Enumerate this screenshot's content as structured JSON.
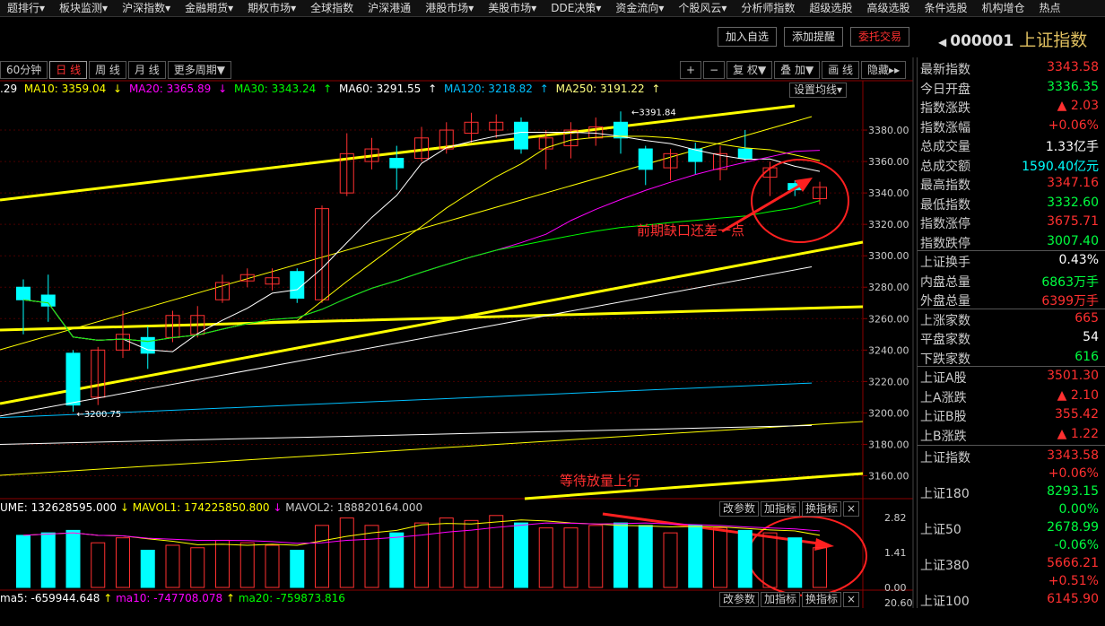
{
  "menu": [
    "题排行▾",
    "板块监测▾",
    "沪深指数▾",
    "金融期货▾",
    "期权市场▾",
    "全球指数",
    "沪深港通",
    "港股市场▾",
    "美股市场▾",
    "DDE决策▾",
    "资金流向▾",
    "个股风云▾",
    "分析师指数",
    "超级选股",
    "高级选股",
    "条件选股",
    "机构增仓",
    "热点"
  ],
  "top_buttons": {
    "add_watch": "加入自选",
    "add_alert": "添加提醒",
    "trade": "委托交易"
  },
  "title": {
    "code": "000001",
    "name": "上证指数"
  },
  "periods": {
    "m60": "60分钟",
    "day": "日 线",
    "week": "周 线",
    "month": "月 线",
    "more": "更多周期▼"
  },
  "tools": {
    "plus": "+",
    "minus": "−",
    "fq": "复 权▼",
    "overlay": "叠 加▼",
    "draw": "画 线",
    "hide": "隐藏▸▸"
  },
  "ma_bar": {
    "ma5": ".29",
    "ma10": "MA10: 3359.04",
    "ma20": "MA20: 3365.89",
    "ma30": "MA30: 3343.24",
    "ma60": "MA60: 3291.55",
    "ma120": "MA120: 3218.82",
    "ma250": "MA250: 3191.22",
    "setting": "设置均线▾"
  },
  "price_axis": {
    "ticks": [
      "3380.00",
      "3360.00",
      "3340.00",
      "3320.00",
      "3300.00",
      "3280.00",
      "3260.00",
      "3240.00",
      "3220.00",
      "3200.00",
      "3180.00",
      "3160.00"
    ]
  },
  "price_labels": {
    "high": "3391.84",
    "low": "3200.75"
  },
  "annotations": {
    "gap": "前期缺口还差一点",
    "wait": "等待放量上行"
  },
  "vol_bar": {
    "vol": "UME: 132628595.000",
    "mavol1": "MAVOL1: 174225850.800",
    "mavol2": "MAVOL2: 188820164.000"
  },
  "vol_tools": {
    "param": "改参数",
    "add": "加指标",
    "swap": "换指标",
    "close": "×"
  },
  "vol_axis": {
    "ticks": [
      "2.82",
      "1.41",
      "0.00"
    ]
  },
  "macd_bar": {
    "ma5": "ma5: -659944.648",
    "ma10": "ma10: -747708.078",
    "ma20": "ma20: -759873.816"
  },
  "macd_axis": {
    "top": "20.60"
  },
  "side": [
    {
      "label": "最新指数",
      "value": "3343.58",
      "color": "#ff3030"
    },
    {
      "label": "今日开盘",
      "value": "3336.35",
      "color": "#00ff40"
    },
    {
      "label": "指数涨跌",
      "value": "▲ 2.03",
      "color": "#ff3030"
    },
    {
      "label": "指数涨幅",
      "value": "+0.06%",
      "color": "#ff3030"
    },
    {
      "label": "总成交量",
      "value": "1.33亿手",
      "color": "#ffffff"
    },
    {
      "label": "总成交额",
      "value": "1590.40亿元",
      "color": "#00ffff"
    },
    {
      "label": "最高指数",
      "value": "3347.16",
      "color": "#ff3030"
    },
    {
      "label": "最低指数",
      "value": "3332.60",
      "color": "#00ff40"
    },
    {
      "label": "指数涨停",
      "value": "3675.71",
      "color": "#ff3030"
    },
    {
      "label": "指数跌停",
      "value": "3007.40",
      "color": "#00ff40"
    },
    {
      "label": "上证换手",
      "value": "0.43%",
      "color": "#ffffff"
    },
    {
      "label": "内盘总量",
      "value": "6863万手",
      "color": "#00ff40"
    },
    {
      "label": "外盘总量",
      "value": "6399万手",
      "color": "#ff3030"
    },
    {
      "label": "上涨家数",
      "value": "665",
      "color": "#ff3030"
    },
    {
      "label": "平盘家数",
      "value": "54",
      "color": "#ffffff"
    },
    {
      "label": "下跌家数",
      "value": "616",
      "color": "#00ff40"
    },
    {
      "label": "上证A股",
      "value": "3501.30",
      "color": "#ff3030"
    },
    {
      "label": "上A涨跌",
      "value": "▲ 2.10",
      "color": "#ff3030"
    },
    {
      "label": "上证B股",
      "value": "355.42",
      "color": "#ff3030"
    },
    {
      "label": "上B涨跌",
      "value": "▲ 1.22",
      "color": "#ff3030"
    }
  ],
  "indices": [
    {
      "label": "上证指数",
      "value": "3343.58",
      "change": "+0.06%",
      "vcolor": "#ff3030",
      "ccolor": "#ff3030"
    },
    {
      "label": "上证180",
      "value": "8293.15",
      "change": "0.00%",
      "vcolor": "#00ff40",
      "ccolor": "#00ff40"
    },
    {
      "label": "上证50",
      "value": "2678.99",
      "change": "-0.06%",
      "vcolor": "#00ff40",
      "ccolor": "#00ff40"
    },
    {
      "label": "上证380",
      "value": "5666.21",
      "change": "+0.51%",
      "vcolor": "#ff3030",
      "ccolor": "#ff3030"
    },
    {
      "label": "上证100",
      "value": "6145.90",
      "change": "",
      "vcolor": "#ff3030",
      "ccolor": "#ff3030"
    }
  ],
  "colors": {
    "up": "#ff3030",
    "down": "#00ffff",
    "ma5": "#ffffff",
    "ma10": "#ffff00",
    "ma20": "#ff00ff",
    "ma30": "#00ff00",
    "ma60": "#ffffff",
    "ma120": "#00c0ff",
    "ma250": "#ffffff",
    "trend": "#ffff00"
  },
  "chart_data": {
    "type": "candlestick",
    "ylim": [
      3150,
      3400
    ],
    "candles": [
      {
        "o": 3280,
        "c": 3272,
        "h": 3285,
        "l": 3250
      },
      {
        "o": 3275,
        "c": 3268,
        "h": 3288,
        "l": 3258
      },
      {
        "o": 3238,
        "c": 3205,
        "h": 3240,
        "l": 3200.75
      },
      {
        "o": 3210,
        "c": 3240,
        "h": 3242,
        "l": 3205
      },
      {
        "o": 3240,
        "c": 3250,
        "h": 3265,
        "l": 3235
      },
      {
        "o": 3248,
        "c": 3238,
        "h": 3255,
        "l": 3228
      },
      {
        "o": 3248,
        "c": 3262,
        "h": 3265,
        "l": 3245
      },
      {
        "o": 3250,
        "c": 3262,
        "h": 3268,
        "l": 3248
      },
      {
        "o": 3272,
        "c": 3283,
        "h": 3288,
        "l": 3270
      },
      {
        "o": 3284,
        "c": 3288,
        "h": 3292,
        "l": 3280
      },
      {
        "o": 3282,
        "c": 3286,
        "h": 3292,
        "l": 3278
      },
      {
        "o": 3290,
        "c": 3273,
        "h": 3292,
        "l": 3270
      },
      {
        "o": 3272,
        "c": 3330,
        "h": 3332,
        "l": 3270
      },
      {
        "o": 3340,
        "c": 3365,
        "h": 3378,
        "l": 3338
      },
      {
        "o": 3360,
        "c": 3368,
        "h": 3375,
        "l": 3355
      },
      {
        "o": 3362,
        "c": 3356,
        "h": 3370,
        "l": 3342
      },
      {
        "o": 3362,
        "c": 3375,
        "h": 3382,
        "l": 3360
      },
      {
        "o": 3368,
        "c": 3380,
        "h": 3385,
        "l": 3365
      },
      {
        "o": 3378,
        "c": 3385,
        "h": 3391,
        "l": 3372
      },
      {
        "o": 3380,
        "c": 3385,
        "h": 3390,
        "l": 3375
      },
      {
        "o": 3385,
        "c": 3368,
        "h": 3388,
        "l": 3365
      },
      {
        "o": 3368,
        "c": 3375,
        "h": 3380,
        "l": 3355
      },
      {
        "o": 3370,
        "c": 3380,
        "h": 3385,
        "l": 3362
      },
      {
        "o": 3375,
        "c": 3382,
        "h": 3388,
        "l": 3370
      },
      {
        "o": 3385,
        "c": 3375,
        "h": 3391.84,
        "l": 3365
      },
      {
        "o": 3368,
        "c": 3355,
        "h": 3370,
        "l": 3345
      },
      {
        "o": 3356,
        "c": 3365,
        "h": 3368,
        "l": 3348
      },
      {
        "o": 3368,
        "c": 3360,
        "h": 3372,
        "l": 3352
      },
      {
        "o": 3355,
        "c": 3365,
        "h": 3370,
        "l": 3348
      },
      {
        "o": 3368,
        "c": 3362,
        "h": 3380,
        "l": 3360
      },
      {
        "o": 3350,
        "c": 3356,
        "h": 3360,
        "l": 3338
      },
      {
        "o": 3346,
        "c": 3342,
        "h": 3348,
        "l": 3338
      },
      {
        "o": 3336.35,
        "c": 3343.58,
        "h": 3347.16,
        "l": 3332.6
      }
    ],
    "volumes": [
      2.1,
      2.2,
      2.3,
      1.8,
      2.0,
      1.5,
      1.7,
      1.6,
      1.9,
      1.8,
      1.7,
      1.5,
      2.5,
      2.8,
      2.5,
      2.2,
      2.6,
      2.8,
      2.7,
      2.9,
      2.6,
      2.4,
      2.4,
      2.5,
      2.6,
      2.5,
      2.2,
      2.5,
      2.4,
      2.3,
      2.2,
      2.0,
      1.6
    ],
    "vol_ylim": [
      0,
      2.82
    ]
  }
}
